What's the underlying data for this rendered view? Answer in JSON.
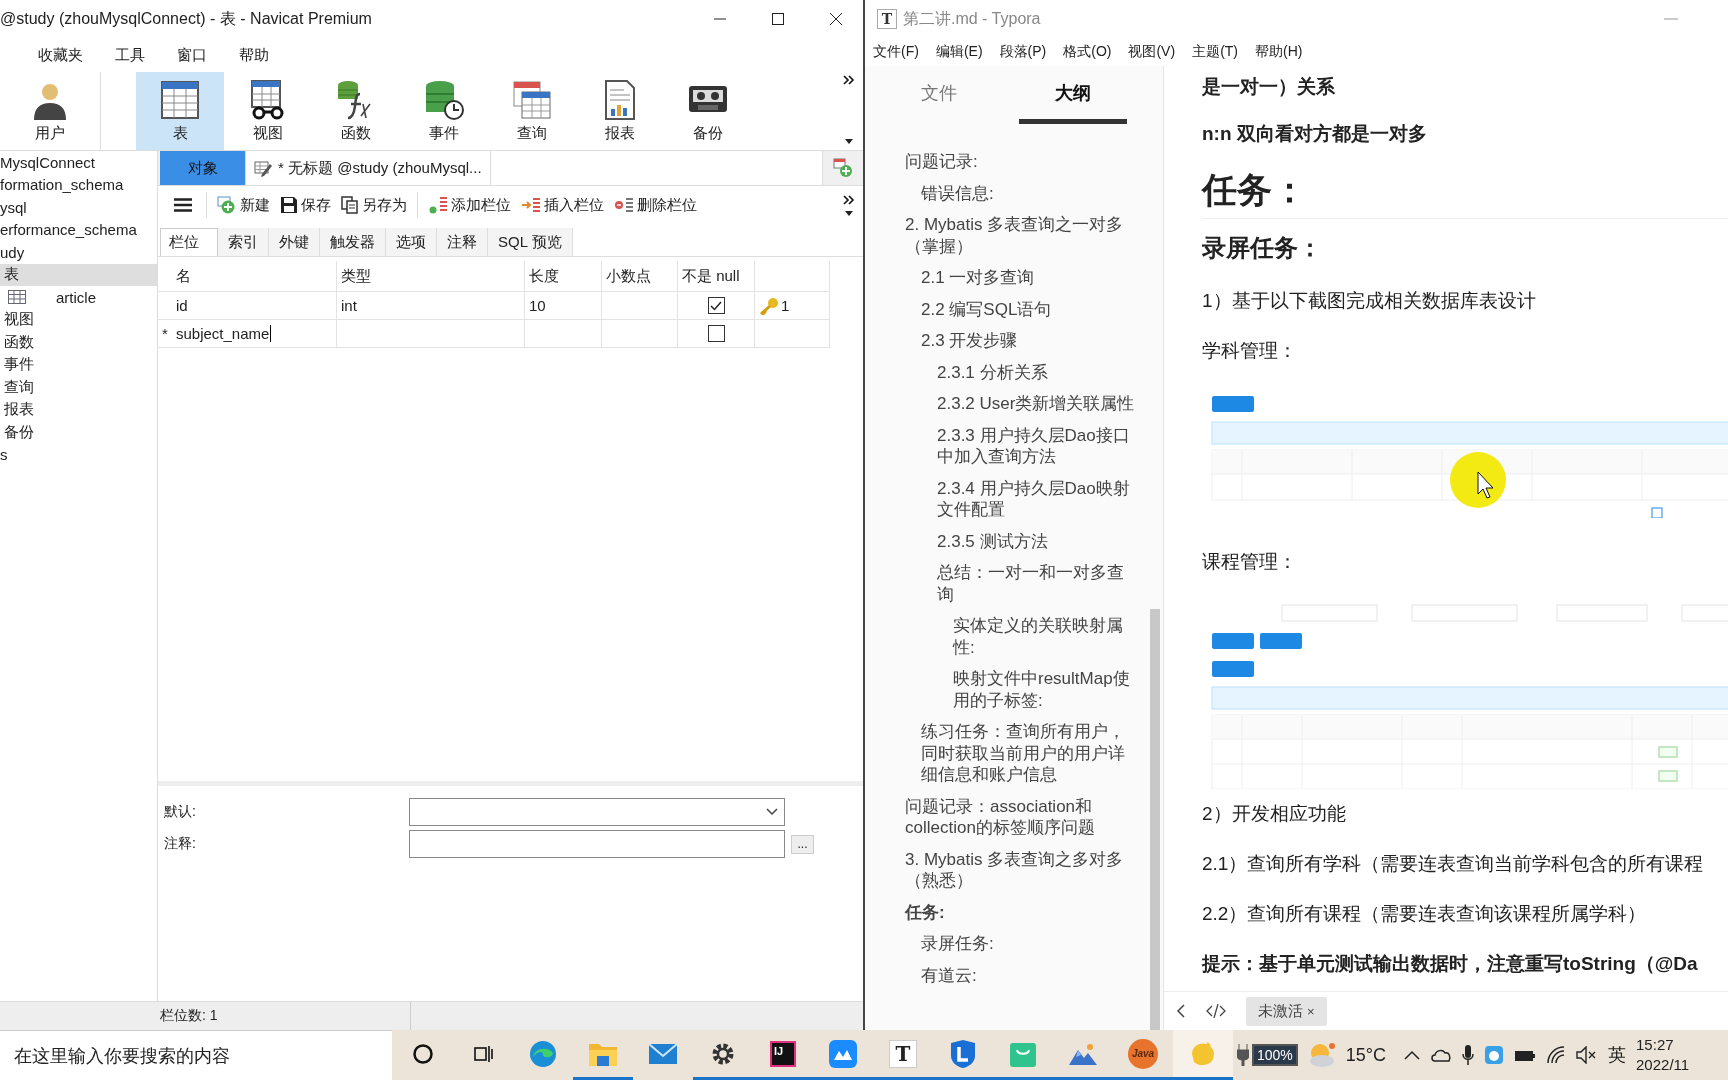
{
  "navicat": {
    "window_title": "@study (zhouMysqlConnect) - 表 - Navicat Premium",
    "menu": [
      "收藏夹",
      "工具",
      "窗口",
      "帮助"
    ],
    "toolbar": [
      {
        "label": "用户",
        "kind": "user",
        "selected": false
      },
      {
        "label": "表",
        "kind": "table",
        "selected": true
      },
      {
        "label": "视图",
        "kind": "view",
        "selected": false
      },
      {
        "label": "函数",
        "kind": "function",
        "selected": false
      },
      {
        "label": "事件",
        "kind": "event",
        "selected": false
      },
      {
        "label": "查询",
        "kind": "query",
        "selected": false
      },
      {
        "label": "报表",
        "kind": "report",
        "selected": false
      },
      {
        "label": "备份",
        "kind": "backup",
        "selected": false
      }
    ],
    "tree": [
      {
        "label": "MysqlConnect",
        "selected": false,
        "children": [
          {
            "label": "formation_schema",
            "selected": false
          },
          {
            "label": "ysql",
            "selected": false
          },
          {
            "label": "erformance_schema",
            "selected": false
          },
          {
            "label": "udy",
            "selected": false,
            "children": [
              {
                "label": "表",
                "selected": true,
                "children": [
                  {
                    "label": "article",
                    "kind": "table",
                    "selected": false
                  }
                ]
              },
              {
                "label": "视图",
                "selected": false
              },
              {
                "label": "函数",
                "selected": false
              },
              {
                "label": "事件",
                "selected": false
              },
              {
                "label": "查询",
                "selected": false
              },
              {
                "label": "报表",
                "selected": false
              },
              {
                "label": "备份",
                "selected": false
              }
            ]
          }
        ]
      },
      {
        "label": "s",
        "selected": false
      }
    ],
    "object_tabs": [
      {
        "label": "对象",
        "selected": true
      },
      {
        "label": "* 无标题 @study (zhouMysql...",
        "selected": false
      }
    ],
    "actions": [
      {
        "label": "新建",
        "kind": "new"
      },
      {
        "label": "保存",
        "kind": "save"
      },
      {
        "label": "另存为",
        "kind": "saveas"
      },
      {
        "label": "添加栏位",
        "kind": "add"
      },
      {
        "label": "插入栏位",
        "kind": "insert"
      },
      {
        "label": "删除栏位",
        "kind": "delete"
      }
    ],
    "editor_tabs": [
      {
        "label": "栏位",
        "selected": true
      },
      {
        "label": "索引",
        "selected": false
      },
      {
        "label": "外键",
        "selected": false
      },
      {
        "label": "触发器",
        "selected": false
      },
      {
        "label": "选项",
        "selected": false
      },
      {
        "label": "注释",
        "selected": false
      },
      {
        "label": "SQL 预览",
        "selected": false
      }
    ],
    "columns": [
      "名",
      "类型",
      "长度",
      "小数点",
      "不是 null"
    ],
    "rows": [
      {
        "name": "id",
        "type": "int",
        "length": "10",
        "not_null": true,
        "primary_key": true,
        "key_order": "1",
        "editing": false
      },
      {
        "marker": "*",
        "name": "subject_name",
        "not_null": false,
        "primary_key": false,
        "editing": true
      }
    ],
    "properties": [
      {
        "label": "默认:",
        "kind": "dropdown"
      },
      {
        "label": "注释:",
        "kind": "text",
        "button": "..."
      }
    ],
    "status": "栏位数: 1"
  },
  "typora": {
    "logo": "T",
    "window_title": "第二讲.md - Typora",
    "menu": [
      "文件(F)",
      "编辑(E)",
      "段落(P)",
      "格式(O)",
      "视图(V)",
      "主题(T)",
      "帮助(H)"
    ],
    "sidebar_tabs": [
      {
        "label": "文件",
        "selected": false
      },
      {
        "label": "大纲",
        "selected": true
      }
    ],
    "outline": [
      {
        "label": "问题记录:",
        "bold": false,
        "children": [
          {
            "label": "错误信息:",
            "bold": false
          }
        ]
      },
      {
        "label": "2. Mybatis 多表查询之一对多（掌握）",
        "bold": false,
        "children": [
          {
            "label": "2.1 一对多查询",
            "bold": false
          },
          {
            "label": "2.2 编写SQL语句",
            "bold": false
          },
          {
            "label": "2.3 开发步骤",
            "bold": false,
            "children": [
              {
                "label": "2.3.1 分析关系",
                "bold": false
              },
              {
                "label": "2.3.2 User类新增关联属性",
                "bold": false
              },
              {
                "label": "2.3.3 用户持久层Dao接口中加入查询方法",
                "bold": false
              },
              {
                "label": "2.3.4 用户持久层Dao映射文件配置",
                "bold": false
              },
              {
                "label": "2.3.5 测试方法",
                "bold": false
              },
              {
                "label": "总结：一对一和一对多查询",
                "bold": false,
                "children": [
                  {
                    "label": "实体定义的关联映射属性:",
                    "bold": false
                  },
                  {
                    "label": "映射文件中resultMap使用的子标签:",
                    "bold": false
                  }
                ]
              }
            ]
          },
          {
            "label": "练习任务：查询所有用户，同时获取当前用户的用户详细信息和账户信息",
            "bold": false
          }
        ]
      },
      {
        "label": "问题记录：association和collection的标签顺序问题",
        "bold": false
      },
      {
        "label": "3. Mybatis 多表查询之多对多（熟悉）",
        "bold": false
      },
      {
        "label": "任务:",
        "bold": true,
        "children": [
          {
            "label": "录屏任务:",
            "bold": false
          },
          {
            "label": "有道云:",
            "bold": false
          }
        ]
      }
    ],
    "content": [
      {
        "kind": "strong",
        "text": "是一对一）关系"
      },
      {
        "kind": "strong",
        "text": "n:n  双向看对方都是一对多"
      },
      {
        "kind": "h1",
        "text": "任务："
      },
      {
        "kind": "h2",
        "text": "录屏任务："
      },
      {
        "kind": "p",
        "text": "1）基于以下截图完成相关数据库表设计"
      },
      {
        "kind": "p",
        "text": "学科管理："
      },
      {
        "kind": "subject-image"
      },
      {
        "kind": "p",
        "text": "课程管理："
      },
      {
        "kind": "course-image"
      },
      {
        "kind": "p",
        "text": "2）开发相应功能"
      },
      {
        "kind": "p",
        "text": "2.1）查询所有学科（需要连表查询当前学科包含的所有课程"
      },
      {
        "kind": "p",
        "text": "2.2）查询所有课程（需要连表查询该课程所属学科）"
      },
      {
        "kind": "strong",
        "text": "提示：基于单元测试输出数据时，注意重写toString（@Da"
      }
    ],
    "badge": "未激活",
    "badge_close": "×"
  },
  "taskbar": {
    "search_placeholder": "在这里输入你要搜索的内容",
    "apps": [
      {
        "kind": "circle",
        "running": false,
        "selected": false
      },
      {
        "kind": "taskview",
        "running": false,
        "selected": false
      },
      {
        "kind": "browser",
        "running": false,
        "selected": false
      },
      {
        "kind": "folder",
        "running": true,
        "selected": false
      },
      {
        "kind": "mail",
        "running": false,
        "selected": false
      },
      {
        "kind": "gear",
        "running": true,
        "selected": false
      },
      {
        "kind": "ide",
        "label": "IJ",
        "running": true,
        "selected": false
      },
      {
        "kind": "cloud",
        "running": true,
        "selected": false
      },
      {
        "kind": "letter",
        "label": "T",
        "running": true,
        "selected": false
      },
      {
        "kind": "shield",
        "running": true,
        "selected": false
      },
      {
        "kind": "bag",
        "running": true,
        "selected": false
      },
      {
        "kind": "mountains",
        "running": true,
        "selected": false
      },
      {
        "kind": "coffee",
        "label": "Java",
        "running": true,
        "selected": false
      },
      {
        "kind": "chick",
        "running": true,
        "selected": true
      }
    ],
    "battery": "100%",
    "temperature": "15°C",
    "ime": "英",
    "time": "15:27",
    "date": "2022/11"
  }
}
